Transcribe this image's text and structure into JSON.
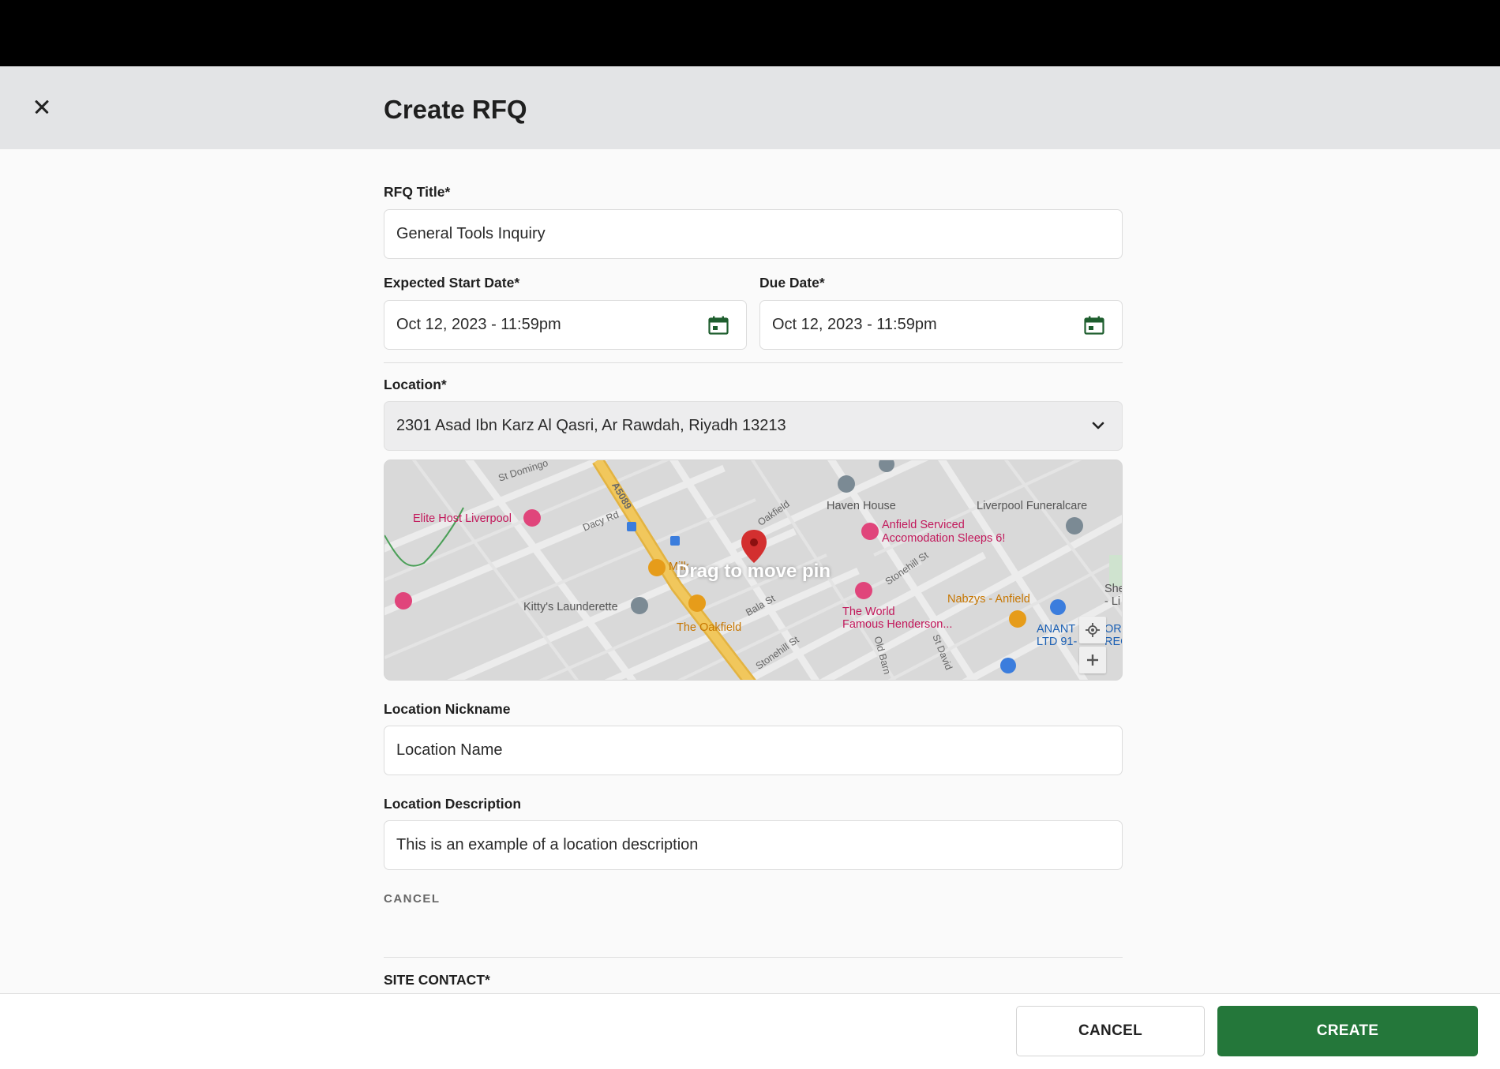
{
  "header": {
    "title": "Create RFQ",
    "close_icon": "close-icon"
  },
  "form": {
    "rfq_title": {
      "label": "RFQ Title*",
      "value": "General Tools Inquiry"
    },
    "start_date": {
      "label": "Expected Start Date*",
      "value": "Oct 12, 2023 - 11:59pm",
      "icon": "calendar-icon"
    },
    "due_date": {
      "label": "Due Date*",
      "value": "Oct 12, 2023 - 11:59pm",
      "icon": "calendar-icon"
    },
    "location": {
      "label": "Location*",
      "value": "2301 Asad Ibn Karz Al Qasri, Ar Rawdah, Riyadh 13213",
      "icon": "chevron-down-icon"
    },
    "map": {
      "overlay_text": "Drag to move pin",
      "labels": {
        "st_domingo": "St Domingo",
        "a5089": "A5089",
        "elite_host": "Elite Host Liverpool",
        "dacy_rd": "Dacy Rd",
        "oakfield": "Oakfield",
        "haven_house": "Haven House",
        "liverpool_funeralcare": "Liverpool Funeralcare",
        "anfield_serviced": "Anfield Serviced",
        "accomodation": "Accomodation Sleeps 6!",
        "milk": "Milk",
        "stonehill_st_1": "Stonehill St",
        "kittys": "Kitty's Launderette",
        "bala_st": "Bala St",
        "the_oakfield": "The Oakfield",
        "world_famous_1": "The World",
        "world_famous_2": "Famous Henderson...",
        "nabzys": "Nabzys - Anfield",
        "stonehill_st_2": "Stonehill St",
        "old_barn": "Old Barn",
        "st_david": "St David",
        "anant_1": "ANANT",
        "anant_2": "LTD 91-",
        "or": "OR",
        "rec": "REC",
        "she": "She",
        "li": "- Li"
      }
    },
    "location_nickname": {
      "label": "Location Nickname",
      "placeholder": "Location Name"
    },
    "location_description": {
      "label": "Location Description",
      "value": "This is an example of a location description"
    },
    "cancel_link": "CANCEL",
    "site_contact_label": "SITE CONTACT*"
  },
  "footer": {
    "cancel_label": "CANCEL",
    "create_label": "CREATE"
  },
  "colors": {
    "primary": "#24773a",
    "header_bg": "#e3e4e6",
    "top_bar": "#000000",
    "pin": "#d32f2f"
  }
}
